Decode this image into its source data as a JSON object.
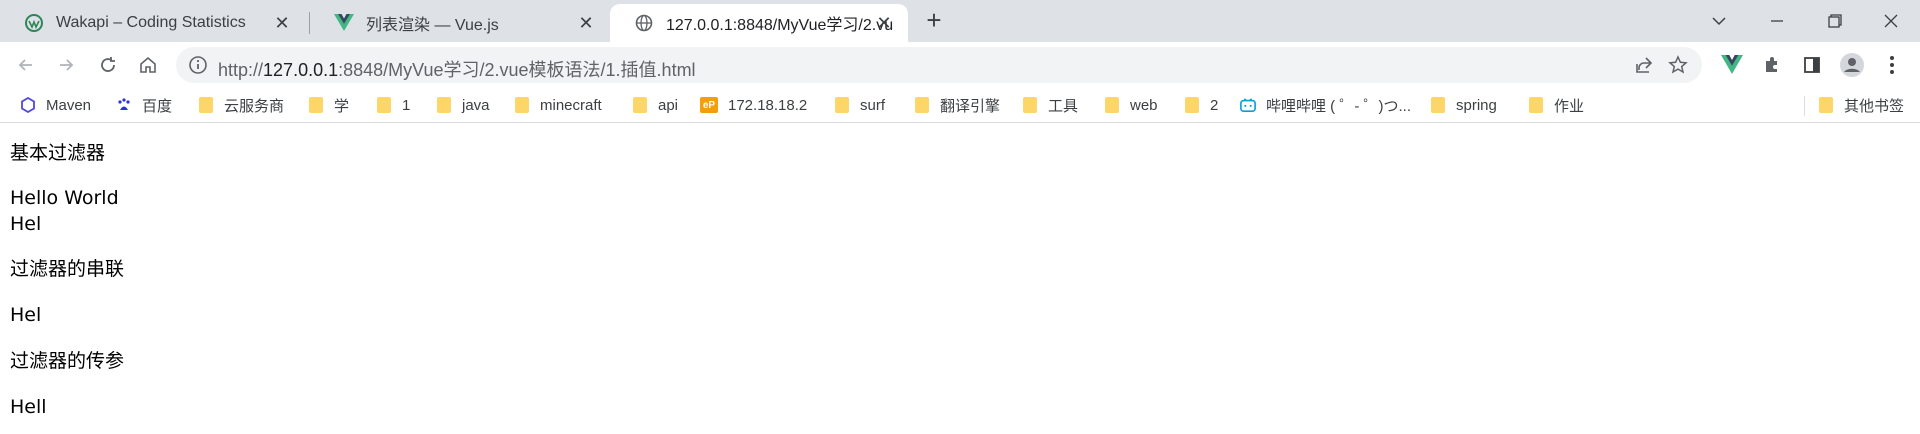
{
  "tabs": [
    {
      "title": "Wakapi – Coding Statistics",
      "icon": "wakapi-icon"
    },
    {
      "title": "列表渲染 — Vue.js",
      "icon": "vue-icon"
    },
    {
      "title": "127.0.0.1:8848/MyVue学习/2.vu",
      "icon": "globe-icon"
    }
  ],
  "address": {
    "prefix": "http://",
    "host": "127.0.0.1",
    "rest": ":8848/MyVue学习/2.vue模板语法/1.插值.html"
  },
  "bookmarks": [
    {
      "label": "Maven",
      "icon": "maven-icon"
    },
    {
      "label": "百度",
      "icon": "baidu-icon"
    },
    {
      "label": "云服务商",
      "icon": "folder-icon"
    },
    {
      "label": "学",
      "icon": "folder-icon"
    },
    {
      "label": "1",
      "icon": "folder-icon"
    },
    {
      "label": "java",
      "icon": "folder-icon"
    },
    {
      "label": "minecraft",
      "icon": "folder-icon"
    },
    {
      "label": "api",
      "icon": "folder-icon"
    },
    {
      "label": "172.18.18.2",
      "icon": "ep-icon"
    },
    {
      "label": "surf",
      "icon": "folder-icon"
    },
    {
      "label": "翻译引擎",
      "icon": "folder-icon"
    },
    {
      "label": "工具",
      "icon": "folder-icon"
    },
    {
      "label": "web",
      "icon": "folder-icon"
    },
    {
      "label": "2",
      "icon": "folder-icon"
    },
    {
      "label": "哔哩哔哩 ( ゜- ゜)つ...",
      "icon": "bilibili-icon"
    },
    {
      "label": "spring",
      "icon": "folder-icon"
    },
    {
      "label": "作业",
      "icon": "folder-icon"
    },
    {
      "label": "其他书签",
      "icon": "folder-icon"
    }
  ],
  "content": {
    "line1": "基本过滤器",
    "line2": "Hello World",
    "line3": "Hel",
    "line4": "过滤器的串联",
    "line5": "Hel",
    "line6": "过滤器的传参",
    "line7": "Hell"
  },
  "colors": {
    "tabstrip": "#dee1e6",
    "omnibox": "#f1f3f4",
    "folder": "#fcd669",
    "vue": "#41b883"
  }
}
